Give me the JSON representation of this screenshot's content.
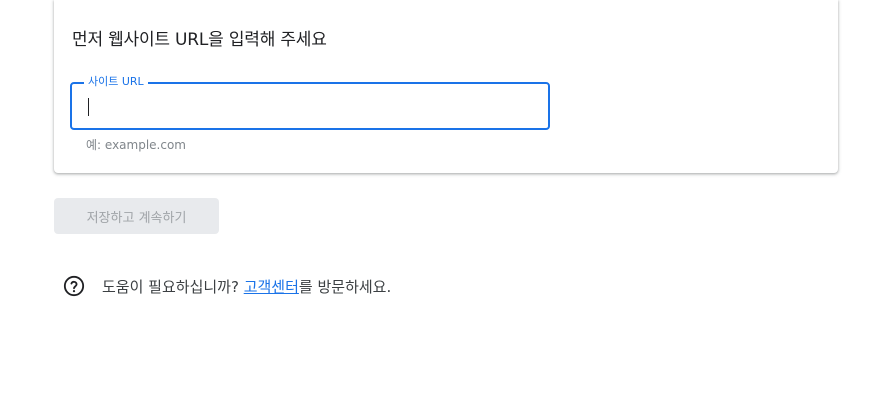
{
  "card": {
    "title": "먼저 웹사이트 URL을 입력해 주세요",
    "field": {
      "label": "사이트 URL",
      "value": "",
      "hint": "예: example.com"
    }
  },
  "actions": {
    "save_continue_label": "저장하고 계속하기"
  },
  "help": {
    "prefix": "도움이 필요하십니까? ",
    "link_label": "고객센터",
    "suffix": "를 방문하세요."
  },
  "colors": {
    "accent": "#1a73e8",
    "disabled_button_bg": "#e8eaed",
    "disabled_button_text": "#a0a4a8"
  },
  "icons": {
    "help": "help-circle-question-icon"
  }
}
